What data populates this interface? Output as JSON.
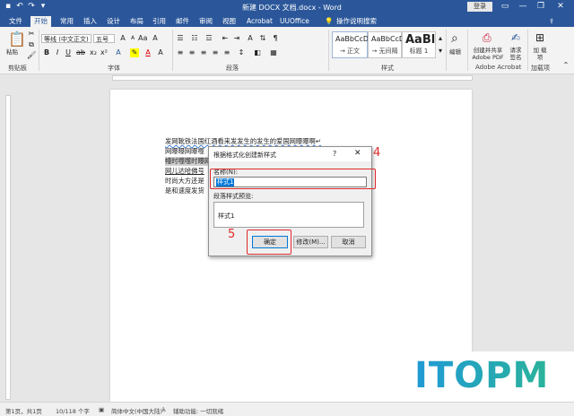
{
  "title_bar": {
    "doc_title": "新建 DOCX 文档.docx - Word",
    "login_label": "登录"
  },
  "tabs": [
    "文件",
    "开始",
    "常用",
    "插入",
    "设计",
    "布局",
    "引用",
    "邮件",
    "审阅",
    "视图",
    "Acrobat",
    "UUOffice"
  ],
  "tell_me": "操作说明搜索",
  "ribbon": {
    "clipboard": {
      "paste_label": "粘贴",
      "group_label": "剪贴板"
    },
    "font": {
      "font_name": "等线 (中文正文)",
      "font_size": "五号",
      "group_label": "字体"
    },
    "paragraph": {
      "group_label": "段落"
    },
    "styles": {
      "group_label": "样式",
      "items": [
        {
          "sample": "AaBbCcDi",
          "name": "→ 正文"
        },
        {
          "sample": "AaBbCcDi",
          "name": "→ 无间隔"
        },
        {
          "sample": "AaBl",
          "name": "标题 1"
        }
      ]
    },
    "editing": {
      "label": "编辑"
    },
    "acrobat": {
      "create_share_label": "创建并共享 Adobe PDF",
      "request_sign_label": "请求 签名",
      "group_label": "Adobe Acrobat"
    },
    "addins": {
      "add_label": "加 载项",
      "group_label": "加载项"
    }
  },
  "document": {
    "lines": [
      "发网靴铁法国红酒看来发发生的发生的爱国网曝曝啊↵",
      "网曝曝网曝噬",
      "幢时噬噬时曝网",
      "网儿达哈佛号",
      "时尚大方还是",
      "是和速度发货"
    ]
  },
  "dialog": {
    "title": "根据格式化创建新样式",
    "help": "?",
    "close": "✕",
    "name_label": "名称(N):",
    "name_value": "样式1",
    "preview_label": "段落样式预览:",
    "preview_text": "样式1",
    "ok_label": "确定",
    "modify_label": "修改(M)...",
    "cancel_label": "取消"
  },
  "annotations": {
    "step_name": "4",
    "step_ok": "5",
    "color": "#e0292a"
  },
  "watermark": "ITOPM",
  "status_bar": {
    "page": "第1页，共1页",
    "words": "10/118 个字",
    "language": "简体中文(中国大陆)",
    "accessibility": "辅助功能: 一切就绪"
  },
  "colors": {
    "title_bar": "#2b579a",
    "accent": "#0078d7"
  }
}
